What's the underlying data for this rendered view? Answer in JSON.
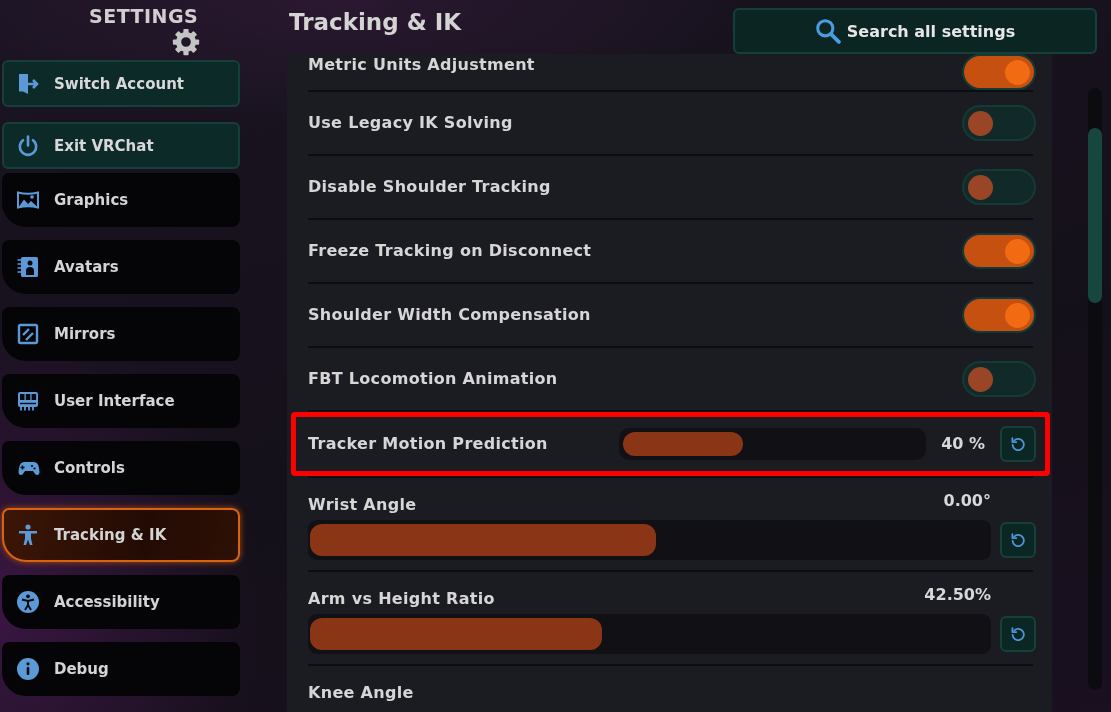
{
  "sidebar": {
    "title": "SETTINGS",
    "actions": [
      {
        "label": "Switch Account"
      },
      {
        "label": "Exit VRChat"
      }
    ],
    "items": [
      {
        "label": "Graphics",
        "selected": false
      },
      {
        "label": "Avatars",
        "selected": false
      },
      {
        "label": "Mirrors",
        "selected": false
      },
      {
        "label": "User Interface",
        "selected": false
      },
      {
        "label": "Controls",
        "selected": false
      },
      {
        "label": "Tracking & IK",
        "selected": true
      },
      {
        "label": "Accessibility",
        "selected": false
      },
      {
        "label": "Debug",
        "selected": false
      }
    ]
  },
  "page": {
    "title": "Tracking & IK",
    "search_button": {
      "label": "Search all settings"
    }
  },
  "settings": [
    {
      "kind": "toggle",
      "label": "Metric Units Adjustment",
      "on": true,
      "highlighted": false
    },
    {
      "kind": "toggle",
      "label": "Use Legacy IK Solving",
      "on": false,
      "highlighted": false
    },
    {
      "kind": "toggle",
      "label": "Disable Shoulder Tracking",
      "on": false,
      "highlighted": false
    },
    {
      "kind": "toggle",
      "label": "Freeze Tracking on Disconnect",
      "on": true,
      "highlighted": false
    },
    {
      "kind": "toggle",
      "label": "Shoulder Width Compensation",
      "on": true,
      "highlighted": false
    },
    {
      "kind": "toggle",
      "label": "FBT Locomotion Animation",
      "on": false,
      "highlighted": false
    },
    {
      "kind": "inline",
      "label": "Tracker Motion Prediction",
      "level": 0.4,
      "reading": "40 %",
      "highlighted": true
    },
    {
      "kind": "slider",
      "label": "Wrist Angle",
      "level": 0.51,
      "reading": "0.00°",
      "highlighted": false
    },
    {
      "kind": "slider",
      "label": "Arm vs Height Ratio",
      "level": 0.43,
      "reading": "42.50%",
      "highlighted": false
    },
    {
      "kind": "slider",
      "label": "Knee Angle",
      "highlighted": false
    }
  ]
}
